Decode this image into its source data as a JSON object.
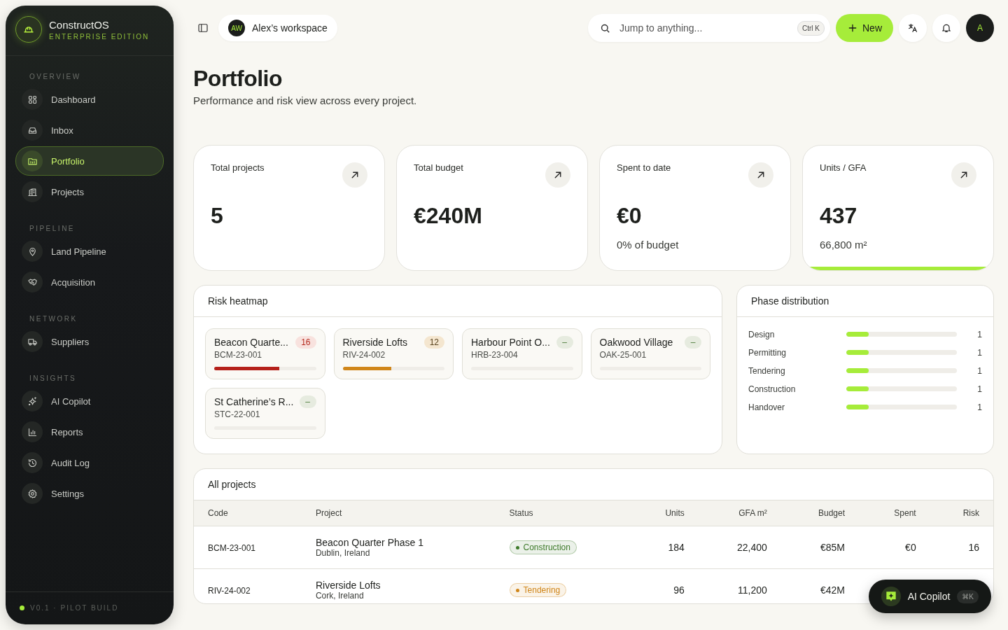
{
  "brand": {
    "name": "ConstructOS",
    "edition": "ENTERPRISE EDITION"
  },
  "sidebar": {
    "sections": [
      {
        "title": "OVERVIEW",
        "items": [
          {
            "label": "Dashboard",
            "selected": false
          },
          {
            "label": "Inbox",
            "selected": false
          },
          {
            "label": "Portfolio",
            "selected": true
          },
          {
            "label": "Projects",
            "selected": false
          }
        ]
      },
      {
        "title": "PIPELINE",
        "items": [
          {
            "label": "Land Pipeline",
            "selected": false
          },
          {
            "label": "Acquisition",
            "selected": false
          }
        ]
      },
      {
        "title": "NETWORK",
        "items": [
          {
            "label": "Suppliers",
            "selected": false
          }
        ]
      },
      {
        "title": "INSIGHTS",
        "items": [
          {
            "label": "AI Copilot",
            "selected": false
          },
          {
            "label": "Reports",
            "selected": false
          },
          {
            "label": "Audit Log",
            "selected": false
          },
          {
            "label": "Settings",
            "selected": false
          }
        ]
      }
    ],
    "footer": "V0.1 · PILOT BUILD"
  },
  "topbar": {
    "workspace": {
      "initials": "AW",
      "name": "Alex’s workspace"
    },
    "search": {
      "placeholder": "Jump to anything...",
      "shortcut": "Ctrl K"
    },
    "new_button": "New",
    "avatar": "A"
  },
  "page": {
    "title": "Portfolio",
    "subtitle": "Performance and risk view across every project."
  },
  "kpis": [
    {
      "label": "Total projects",
      "value": "5"
    },
    {
      "label": "Total budget",
      "value": "€240M"
    },
    {
      "label": "Spent to date",
      "value": "€0",
      "note": "0% of budget"
    },
    {
      "label": "Units / GFA",
      "value": "437",
      "note": "66,800 m²",
      "level": 1
    }
  ],
  "risk_heatmap": {
    "title": "Risk heatmap",
    "cards": [
      {
        "name": "Beacon Quarte...",
        "code": "BCM-23-001",
        "badge": "16",
        "kind": "high",
        "level": 0.64
      },
      {
        "name": "Riverside Lofts",
        "code": "RIV-24-002",
        "badge": "12",
        "kind": "medium",
        "level": 0.48
      },
      {
        "name": "Harbour Point O...",
        "code": "HRB-23-004",
        "badge": "–",
        "kind": "none",
        "level": 0
      },
      {
        "name": "Oakwood Village",
        "code": "OAK-25-001",
        "badge": "–",
        "kind": "none",
        "level": 0
      },
      {
        "name": "St Catherine’s R...",
        "code": "STC-22-001",
        "badge": "–",
        "kind": "none",
        "level": 0
      }
    ]
  },
  "phase_distribution": {
    "title": "Phase distribution",
    "rows": [
      {
        "label": "Design",
        "level": 0.2,
        "count": "1"
      },
      {
        "label": "Permitting",
        "level": 0.2,
        "count": "1"
      },
      {
        "label": "Tendering",
        "level": 0.2,
        "count": "1"
      },
      {
        "label": "Construction",
        "level": 0.2,
        "count": "1"
      },
      {
        "label": "Handover",
        "level": 0.2,
        "count": "1"
      }
    ]
  },
  "table": {
    "title": "All projects",
    "columns": [
      "Code",
      "Project",
      "Status",
      "Units",
      "GFA m²",
      "Budget",
      "Spent",
      "Risk"
    ],
    "rows": [
      {
        "code": "BCM-23-001",
        "project": "Beacon Quarter Phase 1",
        "location": "Dublin, Ireland",
        "status": "Construction",
        "color": "#3d7a2a",
        "units": "184",
        "gfa": "22,400",
        "budget": "€85M",
        "spent": "€0",
        "risk": "16"
      },
      {
        "code": "RIV-24-002",
        "project": "Riverside Lofts",
        "location": "Cork, Ireland",
        "status": "Tendering",
        "color": "#d0861a",
        "units": "96",
        "gfa": "11,200",
        "budget": "€42M"
      }
    ]
  },
  "copilot_button": {
    "label": "AI Copilot",
    "shortcut": "⌘K"
  }
}
